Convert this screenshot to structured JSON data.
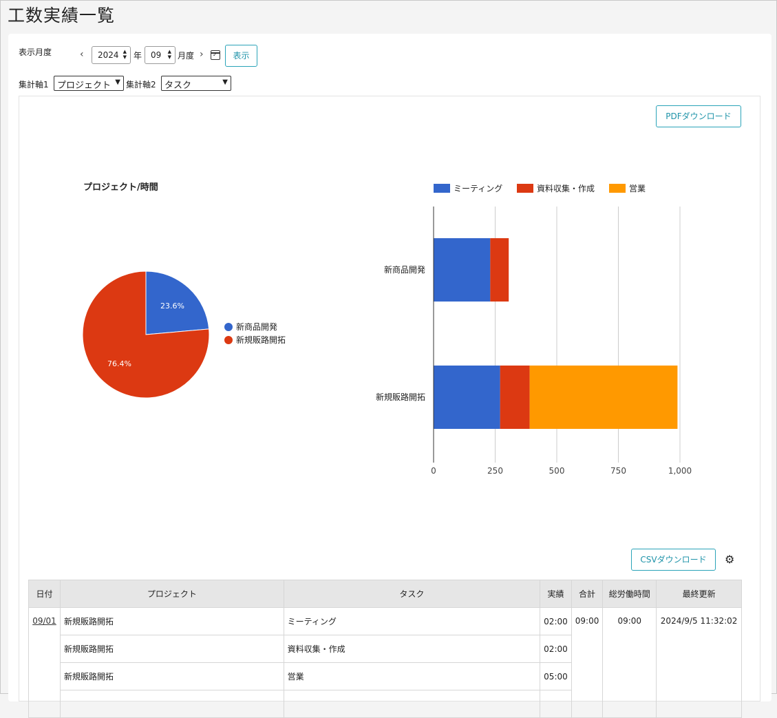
{
  "page": {
    "title": "工数実績一覧"
  },
  "filters": {
    "month_label": "表示月度",
    "prev_icon": "‹",
    "next_icon": "›",
    "year_value": "2024",
    "year_unit": "年",
    "month_value": "09",
    "month_unit": "月度",
    "show_button": "表示",
    "axis1_label": "集計軸1",
    "axis1_value": "プロジェクト",
    "axis2_label": "集計軸2",
    "axis2_value": "タスク"
  },
  "pdf_button": "PDFダウンロード",
  "csv_button": "CSVダウンロード",
  "colors": {
    "blue": "#3366cc",
    "red": "#dc3912",
    "orange": "#ff9900",
    "accent": "#29a3b8"
  },
  "chart_data": [
    {
      "type": "pie",
      "title": "プロジェクト/時間",
      "categories": [
        "新商品開発",
        "新規販路開拓"
      ],
      "values": [
        23.6,
        76.4
      ],
      "labels": [
        "23.6%",
        "76.4%"
      ],
      "colors": [
        "#3366cc",
        "#dc3912"
      ],
      "legend": "right"
    },
    {
      "type": "bar",
      "orientation": "horizontal",
      "stacked": true,
      "categories": [
        "新商品開発",
        "新規販路開拓"
      ],
      "series": [
        {
          "name": "ミーティング",
          "color": "#3366cc",
          "values": [
            230,
            270
          ]
        },
        {
          "name": "資料収集・作成",
          "color": "#dc3912",
          "values": [
            75,
            120
          ]
        },
        {
          "name": "営業",
          "color": "#ff9900",
          "values": [
            0,
            600
          ]
        }
      ],
      "xlim": [
        0,
        1000
      ],
      "ticks": [
        "0",
        "250",
        "500",
        "750",
        "1,000"
      ],
      "grid": true,
      "legend": "top"
    }
  ],
  "table": {
    "headers": [
      "日付",
      "プロジェクト",
      "タスク",
      "実績",
      "合計",
      "総労働時間",
      "最終更新"
    ],
    "date": "09/01",
    "total": "09:00",
    "work_hours": "09:00",
    "updated": "2024/9/5 11:32:02",
    "rows": [
      {
        "project": "新規販路開拓",
        "task": "ミーティング",
        "actual": "02:00"
      },
      {
        "project": "新規販路開拓",
        "task": "資料収集・作成",
        "actual": "02:00"
      },
      {
        "project": "新規販路開拓",
        "task": "営業",
        "actual": "05:00"
      }
    ]
  }
}
